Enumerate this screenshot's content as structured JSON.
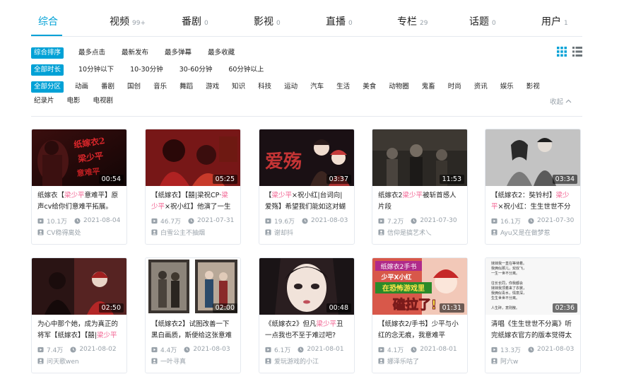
{
  "tabs": [
    {
      "label": "综合",
      "count": ""
    },
    {
      "label": "视频",
      "count": "99+"
    },
    {
      "label": "番剧",
      "count": "0"
    },
    {
      "label": "影视",
      "count": "0"
    },
    {
      "label": "直播",
      "count": "0"
    },
    {
      "label": "专栏",
      "count": "29"
    },
    {
      "label": "话题",
      "count": "0"
    },
    {
      "label": "用户",
      "count": "1"
    }
  ],
  "sort_options": [
    "综合排序",
    "最多点击",
    "最新发布",
    "最多弹幕",
    "最多收藏"
  ],
  "duration_options": [
    "全部时长",
    "10分钟以下",
    "10-30分钟",
    "30-60分钟",
    "60分钟以上"
  ],
  "category_options_row1": [
    "全部分区",
    "动画",
    "番剧",
    "国创",
    "音乐",
    "舞蹈",
    "游戏",
    "知识",
    "科技",
    "运动",
    "汽车",
    "生活",
    "美食",
    "动物圈",
    "鬼畜",
    "时尚",
    "资讯",
    "娱乐",
    "影视"
  ],
  "category_options_row2": [
    "纪录片",
    "电影",
    "电视剧"
  ],
  "collapse_label": "收起",
  "accent_color": "#00a1d6",
  "highlight_color": "#f25d8e",
  "videos": [
    {
      "duration": "00:54",
      "title_pre": "纸嫁衣【",
      "title_hl": "梁少平",
      "title_post": "意难平】原声cv给你们意难平拓展。",
      "views": "10.1万",
      "date": "2021-08-04",
      "uploader": "CV稳得离处"
    },
    {
      "duration": "05:25",
      "title_pre": "【纸嫁衣】【囍|梁祝CP·",
      "title_hl": "梁少平",
      "title_post": "×祝小红】他演了一生",
      "views": "46.7万",
      "date": "2021-07-31",
      "uploader": "白雪公主不抽烟"
    },
    {
      "duration": "03:37",
      "title_pre": "【",
      "title_hl": "梁少平",
      "title_post": "×祝小红|台词向|爱殇】希望我们能如这对蝴",
      "views": "19.6万",
      "date": "2021-08-03",
      "uploader": "谢却抖"
    },
    {
      "duration": "11:53",
      "title_pre": "纸嫁衣2",
      "title_hl": "梁少平",
      "title_post": "被斩首感人片段",
      "views": "7.2万",
      "date": "2021-07-30",
      "uploader": "信仰是搞艺术乀"
    },
    {
      "duration": "03:34",
      "title_pre": "【纸嫁衣2：奘铃村】",
      "title_hl": "梁少平",
      "title_post": "×祝小红：生生世世不分",
      "views": "16.1万",
      "date": "2021-07-30",
      "uploader": "Ayu又是在做梦惹"
    },
    {
      "duration": "02:50",
      "title_pre": "为心中那个她，成为真正的将军【纸嫁衣】【囍|",
      "title_hl": "梁少平",
      "title_post": "",
      "views": "7.4万",
      "date": "2021-08-02",
      "uploader": "问天歌wen"
    },
    {
      "duration": "02:00",
      "title_pre": "【纸嫁衣2】试图改善一下黑白画质，斯便给这张意难",
      "title_hl": "",
      "title_post": "",
      "views": "4.4万",
      "date": "2021-08-03",
      "uploader": "一叶寻真"
    },
    {
      "duration": "00:48",
      "title_pre": "《纸嫁衣2》但凡",
      "title_hl": "梁少平",
      "title_post": "丑一点我也不至于难过吧?",
      "views": "6.1万",
      "date": "2021-08-01",
      "uploader": "爱玩游戏的小江"
    },
    {
      "duration": "01:31",
      "title_pre": "【纸嫁衣2/手书】少平与小红的念无痕，我意难平",
      "title_hl": "",
      "title_post": "",
      "views": "4.1万",
      "date": "2021-08-01",
      "uploader": "娜泽乐咕了"
    },
    {
      "duration": "02:36",
      "title_pre": "清唱《生生世世不分离》听完纸嫁衣官方的版本觉得太",
      "title_hl": "",
      "title_post": "",
      "views": "13.3万",
      "date": "2021-08-03",
      "uploader": "阿六w"
    }
  ],
  "thumb_text": {
    "t1": "纸嫁衣2 梁少平 意难平",
    "t8": "纸嫁衣2手书",
    "t8b": "少平X小红",
    "t8c": "在恐怖游戏里",
    "t8d": "磕拉了!",
    "t10": [
      "妹妹我一直在等待着。",
      "我俩似那儿，双双飞，",
      "一生一世不分离。",
      "",
      "往长长同，你我都会",
      "妹妹我顶着来了衣裳，",
      "我俩似青水，情意深，",
      "生生世世不分离。",
      "",
      "人生碎，意则散。"
    ]
  }
}
